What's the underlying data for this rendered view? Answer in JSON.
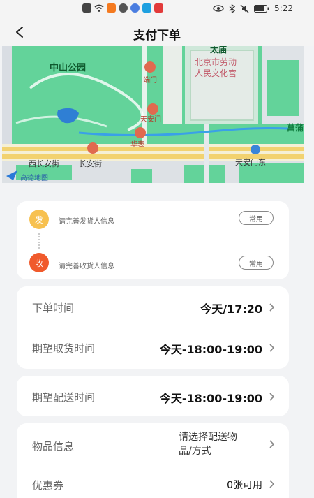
{
  "status_bar": {
    "time": "5:22",
    "left_icons": [
      "notification-icon",
      "wifi-icon",
      "app-icon-orange",
      "app-icon-dark",
      "app-icon-blue",
      "app-icon-cyan",
      "app-icon-red"
    ],
    "right_icons": [
      "eye-icon",
      "bluetooth-icon",
      "mute-icon",
      "battery-icon"
    ]
  },
  "nav": {
    "title": "支付下单"
  },
  "map": {
    "labels": {
      "park": "中山公园",
      "duanmen": "端门",
      "tiananmen": "天安门",
      "huabiao": "华表",
      "palace_line1": "北京市劳动",
      "palace_line2": "人民文化宫",
      "taimiao": "太庙",
      "west_street": "西长安街",
      "changan_street": "长安街",
      "tiananmen_east": "天安门东",
      "logo": "高德地图",
      "right_edge": "菖蒲"
    },
    "colors": {
      "green": "#63d39a",
      "road": "#f2d270",
      "poi": "#e06a4f",
      "route": "#3aa0e8"
    }
  },
  "address": {
    "sender_badge": "发",
    "sender_text": "请完善发货人信息",
    "receiver_badge": "收",
    "receiver_text": "请完善收货人信息",
    "common_label": "常用",
    "sender_color": "#f7c150",
    "receiver_color": "#f05a2c"
  },
  "rows": {
    "order_time_label": "下单时间",
    "order_time_value": "今天/17:20",
    "pickup_label": "期望取货时间",
    "pickup_value": "今天-18:00-19:00",
    "delivery_label": "期望配送时间",
    "delivery_value": "今天-18:00-19:00",
    "item_label": "物品信息",
    "item_value_line1": "请选择配送物",
    "item_value_line2": "品/方式",
    "coupon_label": "优惠券",
    "coupon_value": "0张可用"
  }
}
